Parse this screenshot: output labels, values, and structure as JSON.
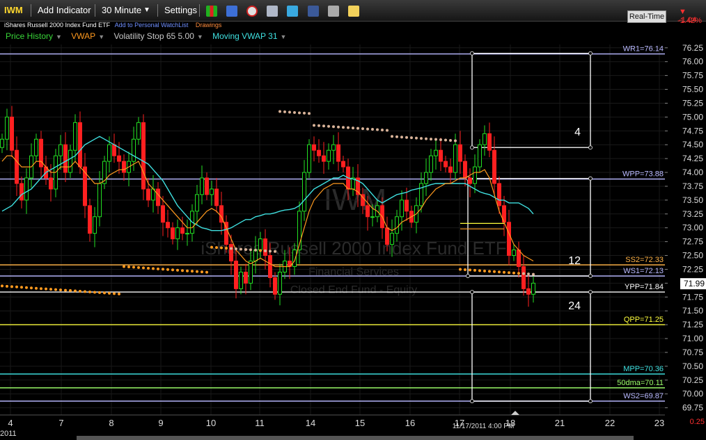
{
  "toolbar": {
    "symbol": "IWM",
    "add_indicator": "Add Indicator",
    "interval": "30 Minute",
    "settings": "Settings",
    "realtime": "Real-Time",
    "change": "-1.04",
    "change_pct": "-1.42%",
    "icons": [
      "bar-chart-icon",
      "save-icon",
      "alarm-icon",
      "layers-icon",
      "twitter-icon",
      "facebook-icon",
      "binoculars-icon",
      "note-icon"
    ]
  },
  "header": {
    "title": "iShares Russell 2000 Index Fund ETF",
    "watchlist_link": "Add to Personal WatchList",
    "drawings_link": "Drawings"
  },
  "indicators": [
    {
      "label": "Price History",
      "color": "#39d639"
    },
    {
      "label": "VWAP",
      "color": "#ff9a1f"
    },
    {
      "label": "Volatility Stop 65 5.00",
      "color": "#c9c9c9"
    },
    {
      "label": "Moving VWAP 31",
      "color": "#3fe0e0"
    }
  ],
  "watermark": {
    "symbol": "IWM",
    "name": "iShares Russell 2000 Index Fund ETF",
    "sector": "Financial Services",
    "type": "Closed End Fund - Equity"
  },
  "chart_data": {
    "type": "candlestick",
    "y_range": [
      69.62,
      76.31
    ],
    "y_ticks": [
      "76.25",
      "76.00",
      "75.75",
      "75.50",
      "75.25",
      "75.00",
      "74.75",
      "74.50",
      "74.25",
      "74.00",
      "73.75",
      "73.50",
      "73.25",
      "73.00",
      "72.75",
      "72.50",
      "72.25",
      "72.00",
      "71.75",
      "71.50",
      "71.25",
      "71.00",
      "70.75",
      "70.50",
      "70.25",
      "70.00",
      "69.75"
    ],
    "x_labels": [
      "4",
      "7",
      "8",
      "9",
      "10",
      "11",
      "14",
      "15",
      "16",
      "17",
      "18",
      "21",
      "22",
      "23"
    ],
    "x_year_label": "2011",
    "last_price": "71.99",
    "bottom_value": "0.25",
    "cursor_time": "11/17/2011 4:00 PM",
    "closes": [
      74.6,
      75.0,
      74.4,
      73.8,
      73.5,
      73.9,
      74.3,
      74.6,
      74.1,
      73.9,
      73.7,
      74.3,
      74.5,
      74.0,
      74.4,
      74.9,
      74.1,
      73.4,
      72.9,
      73.2,
      73.8,
      74.2,
      74.5,
      74.3,
      74.2,
      74.0,
      74.2,
      74.6,
      74.9,
      73.7,
      73.5,
      73.7,
      73.4,
      73.1,
      73.0,
      72.8,
      73.0,
      72.9,
      72.9,
      73.3,
      73.6,
      73.9,
      73.6,
      73.7,
      73.4,
      73.1,
      72.7,
      72.4,
      71.9,
      72.2,
      72.0,
      72.4,
      72.6,
      72.8,
      72.5,
      72.1,
      71.8,
      72.2,
      72.4,
      72.3,
      72.6,
      73.3,
      74.0,
      74.5,
      74.4,
      74.3,
      74.2,
      74.4,
      74.5,
      74.2,
      74.1,
      73.7,
      73.9,
      73.6,
      73.4,
      73.2,
      73.2,
      73.4,
      73.0,
      72.7,
      72.9,
      73.2,
      73.5,
      73.3,
      73.1,
      73.4,
      73.8,
      74.0,
      74.3,
      74.4,
      74.2,
      74.1,
      74.0,
      74.5,
      74.2,
      73.9,
      73.8,
      74.1,
      74.5,
      74.7,
      74.4,
      73.8,
      73.4,
      73.1,
      72.5,
      72.6,
      72.3,
      71.9,
      71.8,
      72.0
    ],
    "vwap": [
      74.2,
      74.3,
      74.3,
      74.2,
      74.1,
      74.1,
      74.1,
      74.2,
      74.2,
      74.1,
      74.0,
      74.0,
      74.1,
      74.1,
      74.1,
      74.2,
      74.1,
      74.0,
      73.9,
      73.8,
      73.8,
      73.85,
      73.95,
      74.0,
      74.05,
      74.05,
      74.1,
      74.15,
      74.2,
      74.0,
      73.8,
      73.7,
      73.6,
      73.5,
      73.4,
      73.3,
      73.2,
      73.1,
      73.0,
      73.0,
      73.1,
      73.2,
      73.3,
      73.35,
      73.3,
      73.2,
      73.0,
      72.8,
      72.6,
      72.5,
      72.4,
      72.35,
      72.4,
      72.45,
      72.4,
      72.35,
      72.3,
      72.3,
      72.3,
      72.3,
      72.4,
      72.7,
      73.0,
      73.3,
      73.5,
      73.6,
      73.7,
      73.75,
      73.8,
      73.8,
      73.8,
      73.7,
      73.7,
      73.65,
      73.55,
      73.45,
      73.35,
      73.3,
      73.2,
      73.0,
      72.95,
      73.0,
      73.1,
      73.15,
      73.2,
      73.25,
      73.35,
      73.5,
      73.6,
      73.7,
      73.75,
      73.8,
      73.8,
      73.85,
      73.9,
      73.9,
      73.95,
      74.0,
      74.0,
      74.05,
      73.9,
      73.6,
      73.3,
      73.1,
      72.9,
      72.7,
      72.6,
      72.5,
      72.45,
      72.4
    ],
    "mvwap": [
      73.3,
      73.35,
      73.4,
      73.5,
      73.6,
      73.65,
      73.7,
      73.8,
      73.9,
      74.0,
      74.05,
      74.1,
      74.15,
      74.2,
      74.25,
      74.3,
      74.4,
      74.5,
      74.55,
      74.6,
      74.65,
      74.6,
      74.55,
      74.5,
      74.45,
      74.4,
      74.35,
      74.3,
      74.25,
      74.2,
      74.15,
      74.05,
      73.95,
      73.85,
      73.7,
      73.55,
      73.4,
      73.3,
      73.2,
      73.1,
      73.05,
      73.0,
      72.98,
      72.95,
      72.95,
      72.95,
      72.97,
      73.0,
      73.05,
      73.1,
      73.15,
      73.15,
      73.2,
      73.22,
      73.25,
      73.25,
      73.27,
      73.3,
      73.32,
      73.33,
      73.35,
      73.4,
      73.5,
      73.6,
      73.7,
      73.75,
      73.8,
      73.85,
      73.9,
      73.9,
      73.95,
      73.9,
      73.88,
      73.85,
      73.8,
      73.7,
      73.6,
      73.5,
      73.45,
      73.5,
      73.55,
      73.6,
      73.62,
      73.64,
      73.68,
      73.7,
      73.72,
      73.75,
      73.78,
      73.8,
      73.8,
      73.8,
      73.8,
      73.8,
      73.8,
      73.8,
      73.75,
      73.7,
      73.65,
      73.62,
      73.6,
      73.55,
      73.5,
      73.5,
      73.45,
      73.45,
      73.45,
      73.4,
      73.35,
      73.25
    ],
    "pivot_levels": [
      {
        "label": "WR1=76.14",
        "value": 76.14,
        "color": "#b9b9ff"
      },
      {
        "label": "WPP=73.88",
        "value": 73.88,
        "color": "#b9b9ff"
      },
      {
        "label": "SS2=72.33",
        "value": 72.33,
        "color": "#ffb347"
      },
      {
        "label": "WS1=72.13",
        "value": 72.13,
        "color": "#b9b9ff"
      },
      {
        "label": "YPP=71.84",
        "value": 71.84,
        "color": "#ffffff"
      },
      {
        "label": "QPP=71.25",
        "value": 71.25,
        "color": "#ffff3c"
      },
      {
        "label": "MPP=70.36",
        "value": 70.36,
        "color": "#3fe0e0"
      },
      {
        "label": "50dma=70.11",
        "value": 70.11,
        "color": "#9dff6b"
      },
      {
        "label": "WS2=69.87",
        "value": 69.87,
        "color": "#b9b9ff"
      }
    ],
    "boxes": [
      {
        "label": "4",
        "top": 76.15,
        "bottom": 74.45
      },
      {
        "label": "12",
        "top": 73.89,
        "bottom": 72.13
      },
      {
        "label": "24",
        "top": 71.84,
        "bottom": 69.87
      }
    ],
    "vstop": [
      {
        "from": 0,
        "to": 24,
        "value": 71.95
      },
      {
        "from": 25,
        "to": 42,
        "value": 72.3
      },
      {
        "from": 43,
        "to": 56,
        "value": 72.65
      },
      {
        "from": 57,
        "to": 63,
        "value": 75.1
      },
      {
        "from": 64,
        "to": 79,
        "value": 74.85
      },
      {
        "from": 80,
        "to": 93,
        "value": 74.65
      },
      {
        "from": 94,
        "to": 109,
        "value": 72.25
      }
    ]
  }
}
